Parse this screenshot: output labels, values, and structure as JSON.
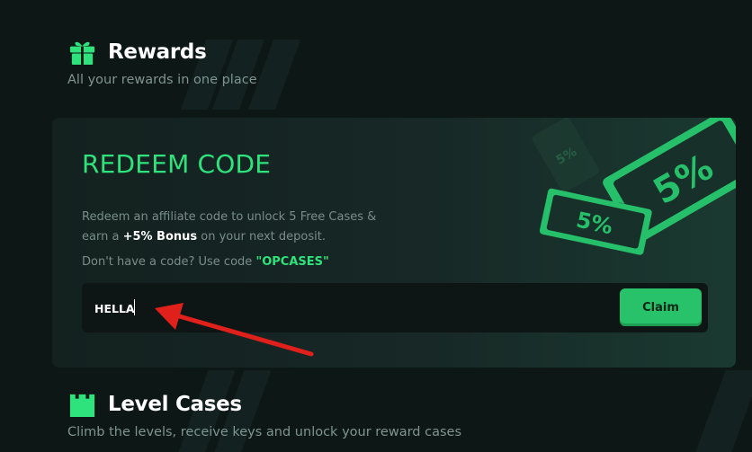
{
  "rewards": {
    "title": "Rewards",
    "subtitle": "All your rewards in one place"
  },
  "redeem": {
    "title": "REDEEM CODE",
    "desc_before": "Redeem an affiliate code to unlock 5 Free Cases & earn a",
    "desc_bonus": "+5% Bonus",
    "desc_after": "on your next deposit.",
    "hint_prefix": "Don't have a code? Use code",
    "hint_code": "\"OPCASES\"",
    "input_value": "HELLA",
    "claim_label": "Claim",
    "ticket_labels": [
      "5%",
      "5%",
      "5%"
    ]
  },
  "level_cases": {
    "title": "Level Cases",
    "subtitle": "Climb the levels, receive keys and unlock your reward cases"
  },
  "colors": {
    "accent_green": "#2ee37c",
    "button_green": "#27c269",
    "annotation_arrow": "#e0201b"
  }
}
